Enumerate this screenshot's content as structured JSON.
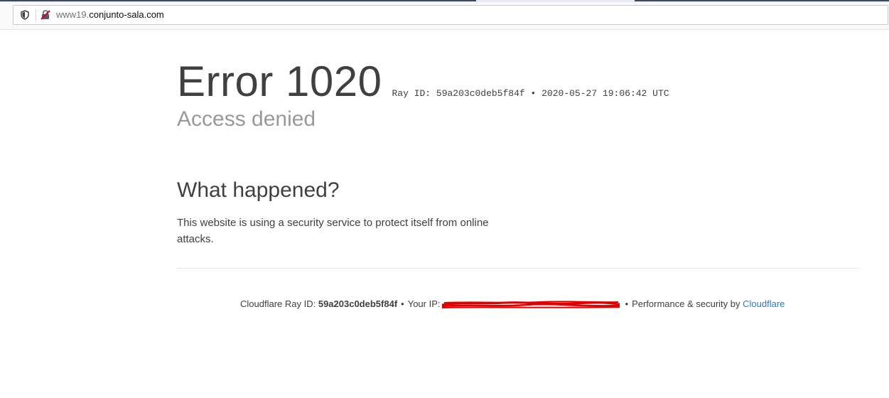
{
  "browser": {
    "url_prefix": "www19.",
    "url_domain": "conjunto-sala.com",
    "icons": [
      "shield-icon",
      "insecure-lock-icon"
    ]
  },
  "page": {
    "error_title": "Error 1020",
    "ray_line": "Ray ID: 59a203c0deb5f84f • 2020-05-27 19:06:42 UTC",
    "subtitle": "Access denied",
    "what_heading": "What happened?",
    "what_body": "This website is using a security service to protect itself from online attacks."
  },
  "footer": {
    "ray_label": "Cloudflare Ray ID:",
    "ray_id": "59a203c0deb5f84f",
    "bullet": "•",
    "ip_label": "Your IP:",
    "perf_label": "Performance & security by",
    "cf_link": "Cloudflare"
  },
  "colors": {
    "link": "#2f7bbf",
    "redaction": "#e00000",
    "heading": "#404040",
    "subtitle": "#999999"
  }
}
